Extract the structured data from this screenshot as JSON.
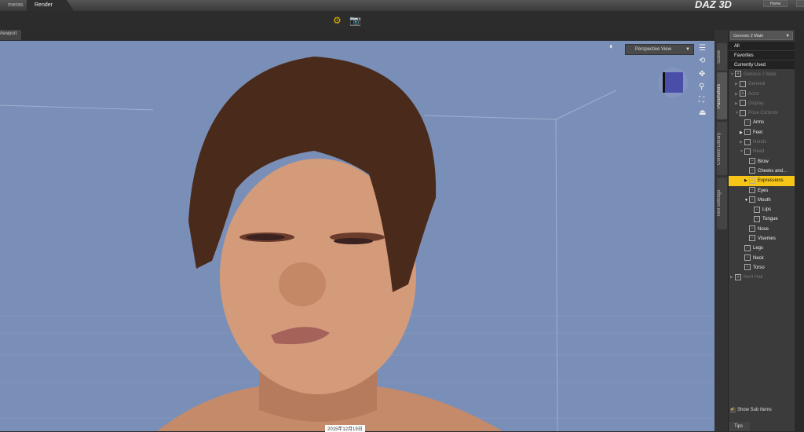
{
  "topbar": {
    "tabs": [
      "meras",
      "Render"
    ],
    "logo": "DAZ 3D",
    "home": "Home"
  },
  "viewport": {
    "tab": "Viewport",
    "view": "Perspective View",
    "date": "2015年12月19日"
  },
  "side_tabs": [
    "Scene",
    "Parameters",
    "Content Library",
    "Tool Settings"
  ],
  "panel": {
    "figure": "Genesis 2 Male",
    "filters": [
      "All",
      "Favorites",
      "Currently Used"
    ],
    "tree": [
      {
        "label": "Genesis 2 Male",
        "indent": 0,
        "arrow": "▼",
        "dim": true,
        "icon": "figure"
      },
      {
        "label": "General",
        "indent": 1,
        "arrow": "▶",
        "dim": true
      },
      {
        "label": "Actor",
        "indent": 1,
        "arrow": "▶",
        "dim": true,
        "icon": "actor"
      },
      {
        "label": "Display",
        "indent": 1,
        "arrow": "▶",
        "dim": true
      },
      {
        "label": "Pose Controls",
        "indent": 1,
        "arrow": "▼",
        "dim": true
      },
      {
        "label": "Arms",
        "indent": 2,
        "arrow": ""
      },
      {
        "label": "Feet",
        "indent": 2,
        "arrow": "▶"
      },
      {
        "label": "Hands",
        "indent": 2,
        "arrow": "▶",
        "dim": true
      },
      {
        "label": "Head",
        "indent": 2,
        "arrow": "▼",
        "dim": true
      },
      {
        "label": "Brow",
        "indent": 3,
        "arrow": ""
      },
      {
        "label": "Cheeks and...",
        "indent": 3,
        "arrow": ""
      },
      {
        "label": "Expressions",
        "indent": 3,
        "arrow": "▶",
        "selected": true
      },
      {
        "label": "Eyes",
        "indent": 3,
        "arrow": ""
      },
      {
        "label": "Mouth",
        "indent": 3,
        "arrow": "▼"
      },
      {
        "label": "Lips",
        "indent": 4,
        "arrow": ""
      },
      {
        "label": "Tongue",
        "indent": 4,
        "arrow": ""
      },
      {
        "label": "Nose",
        "indent": 3,
        "arrow": ""
      },
      {
        "label": "Visemes",
        "indent": 3,
        "arrow": ""
      },
      {
        "label": "Legs",
        "indent": 2,
        "arrow": ""
      },
      {
        "label": "Neck",
        "indent": 2,
        "arrow": ""
      },
      {
        "label": "Torso",
        "indent": 2,
        "arrow": ""
      },
      {
        "label": "Kent Hair",
        "indent": 0,
        "arrow": "▶",
        "dim": true,
        "icon": "figure"
      }
    ],
    "show_sub_items": "Show Sub Items",
    "tips": "Tips"
  }
}
